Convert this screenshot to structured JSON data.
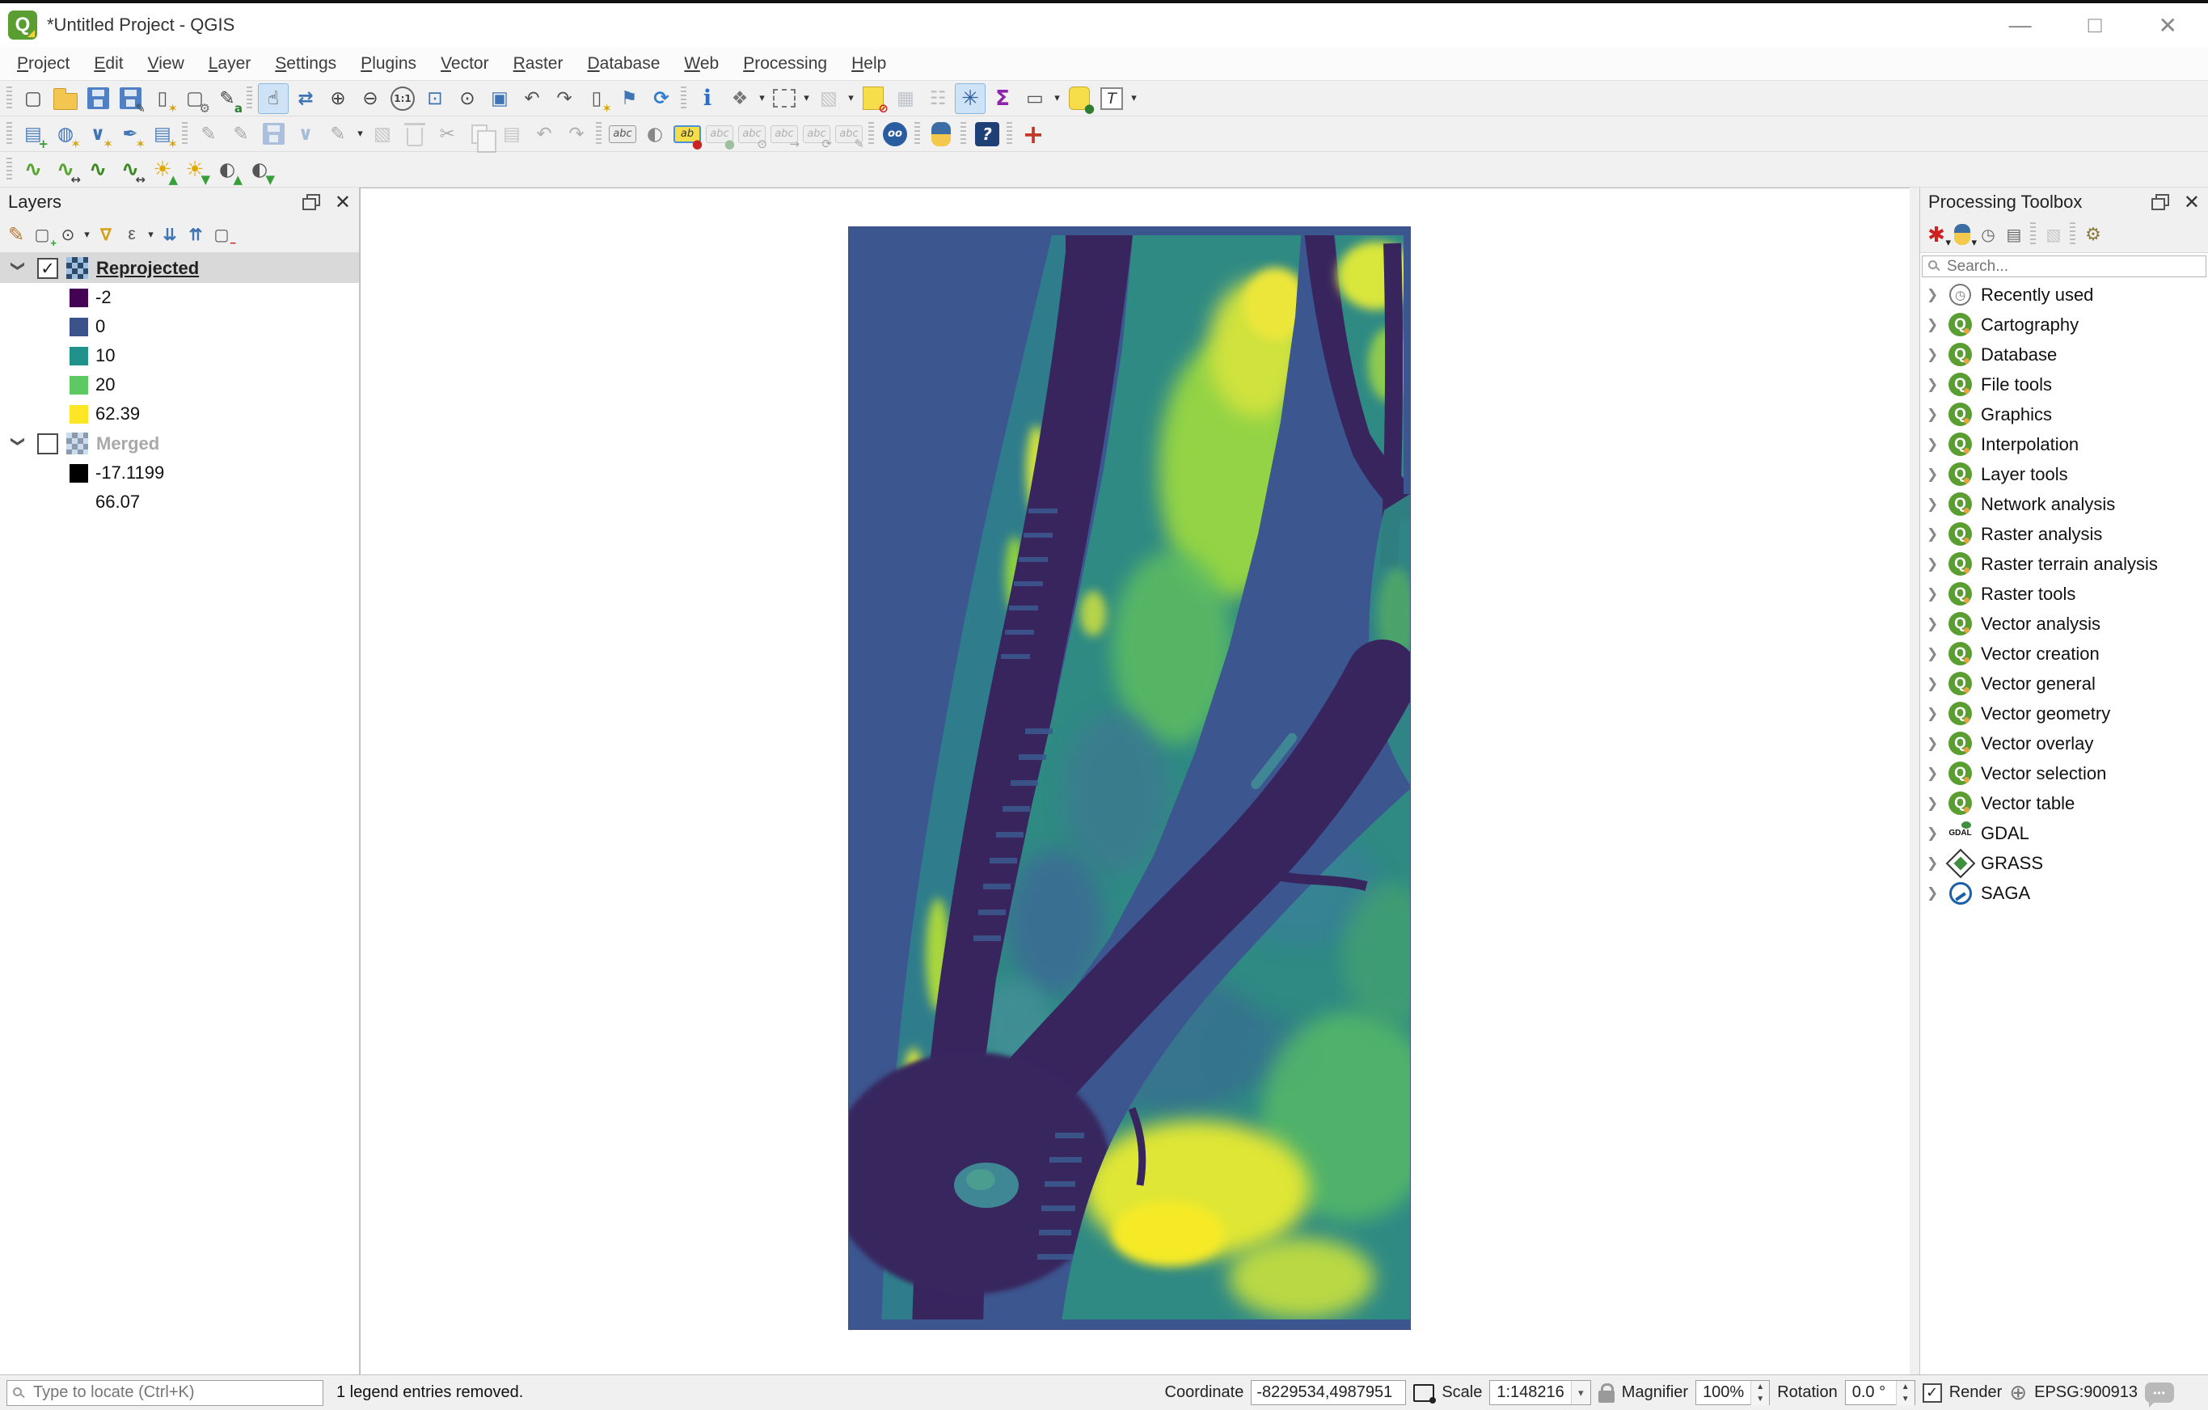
{
  "window": {
    "title": "*Untitled Project - QGIS",
    "controls": [
      "minimize-icon",
      "maximize-icon",
      "close-icon"
    ]
  },
  "menu": {
    "items": [
      "Project",
      "Edit",
      "View",
      "Layer",
      "Settings",
      "Plugins",
      "Vector",
      "Raster",
      "Database",
      "Web",
      "Processing",
      "Help"
    ]
  },
  "toolbars": {
    "row1": [
      "new-project",
      "open-project",
      "save-project",
      "save-project-as",
      "new-print-layout",
      "show-layout-manager",
      "style-manager",
      "pan-map",
      "pan-to-selection",
      "zoom-in",
      "zoom-out",
      "zoom-native",
      "zoom-full",
      "zoom-to-selection",
      "zoom-to-layer",
      "zoom-last",
      "zoom-next",
      "new-bookmark",
      "show-bookmarks",
      "refresh",
      "identify-features",
      "run-feature-action",
      "select-features",
      "deselect-features",
      "clear-selection",
      "open-attribute-table",
      "field-calculator",
      "processing-toolbox",
      "statistical-summary",
      "measure",
      "map-tips",
      "text-annotation"
    ],
    "row1_active": "processing-toolbox and pan-map highlighted",
    "row2": [
      "data-source-manager",
      "new-geopackage-layer",
      "new-shapefile-layer",
      "new-spatialite-layer",
      "new-memory-layer",
      "current-edits",
      "toggle-editing",
      "save-layer-edits",
      "add-feature",
      "advanced-digitizing",
      "modify-attributes",
      "delete-selected",
      "cut-features",
      "copy-features",
      "paste-features",
      "undo",
      "redo",
      "layer-labeling",
      "layer-diagram",
      "pin-labels",
      "unpin-labels",
      "show-hide-labels",
      "move-label",
      "rotate-label",
      "change-label",
      "metasearch",
      "python-console",
      "help-contents",
      "cursor-crosshair"
    ],
    "row3": [
      "local-histogram-stretch",
      "full-histogram-stretch",
      "local-cumulative-cut-stretch",
      "full-cumulative-cut-stretch",
      "increase-brightness",
      "decrease-brightness",
      "increase-contrast",
      "decrease-contrast"
    ]
  },
  "layers_panel": {
    "title": "Layers",
    "toolbar": [
      "open-layer-styling",
      "add-group",
      "manage-map-themes",
      "filter-legend",
      "filter-by-expression",
      "expand-all",
      "collapse-all",
      "remove-layer"
    ],
    "layers": [
      {
        "name": "Reprojected",
        "checked": true,
        "selected": true,
        "legend": [
          {
            "value": "-2",
            "color": "#440154"
          },
          {
            "value": "0",
            "color": "#3b528b"
          },
          {
            "value": "10",
            "color": "#21918c"
          },
          {
            "value": "20",
            "color": "#5ec962"
          },
          {
            "value": "62.39",
            "color": "#fde725"
          }
        ]
      },
      {
        "name": "Merged",
        "checked": false,
        "selected": false,
        "legend": [
          {
            "value": "-17.1199",
            "color": "#000000"
          },
          {
            "value": "66.07",
            "color": "#ffffff"
          }
        ]
      }
    ]
  },
  "toolbox": {
    "title": "Processing Toolbox",
    "toolbar": [
      "models",
      "scripts",
      "history",
      "results-viewer",
      "edit-features-in-place",
      "options"
    ],
    "search_placeholder": "Search...",
    "groups": [
      {
        "label": "Recently used",
        "icon": "clock-icon"
      },
      {
        "label": "Cartography",
        "icon": "qgis-icon"
      },
      {
        "label": "Database",
        "icon": "qgis-icon"
      },
      {
        "label": "File tools",
        "icon": "qgis-icon"
      },
      {
        "label": "Graphics",
        "icon": "qgis-icon"
      },
      {
        "label": "Interpolation",
        "icon": "qgis-icon"
      },
      {
        "label": "Layer tools",
        "icon": "qgis-icon"
      },
      {
        "label": "Network analysis",
        "icon": "qgis-icon"
      },
      {
        "label": "Raster analysis",
        "icon": "qgis-icon"
      },
      {
        "label": "Raster terrain analysis",
        "icon": "qgis-icon"
      },
      {
        "label": "Raster tools",
        "icon": "qgis-icon"
      },
      {
        "label": "Vector analysis",
        "icon": "qgis-icon"
      },
      {
        "label": "Vector creation",
        "icon": "qgis-icon"
      },
      {
        "label": "Vector general",
        "icon": "qgis-icon"
      },
      {
        "label": "Vector geometry",
        "icon": "qgis-icon"
      },
      {
        "label": "Vector overlay",
        "icon": "qgis-icon"
      },
      {
        "label": "Vector selection",
        "icon": "qgis-icon"
      },
      {
        "label": "Vector table",
        "icon": "qgis-icon"
      },
      {
        "label": "GDAL",
        "icon": "gdal-icon"
      },
      {
        "label": "GRASS",
        "icon": "grass-icon"
      },
      {
        "label": "SAGA",
        "icon": "saga-icon"
      }
    ]
  },
  "map": {
    "description": "Viridis-styled elevation raster of the New York City area (Manhattan, Bronx, Brooklyn, Hudson and East Rivers)",
    "palette": [
      "#440154",
      "#3b528b",
      "#21918c",
      "#5ec962",
      "#fde725"
    ]
  },
  "statusbar": {
    "locate_placeholder": "Type to locate (Ctrl+K)",
    "message": "1 legend entries removed.",
    "coordinate_label": "Coordinate",
    "coordinate_value": "-8229534,4987951",
    "scale_label": "Scale",
    "scale_value": "1:148216",
    "magnifier_label": "Magnifier",
    "magnifier_value": "100%",
    "rotation_label": "Rotation",
    "rotation_value": "0.0 °",
    "render_label": "Render",
    "render_checked": true,
    "crs": "EPSG:900913"
  }
}
